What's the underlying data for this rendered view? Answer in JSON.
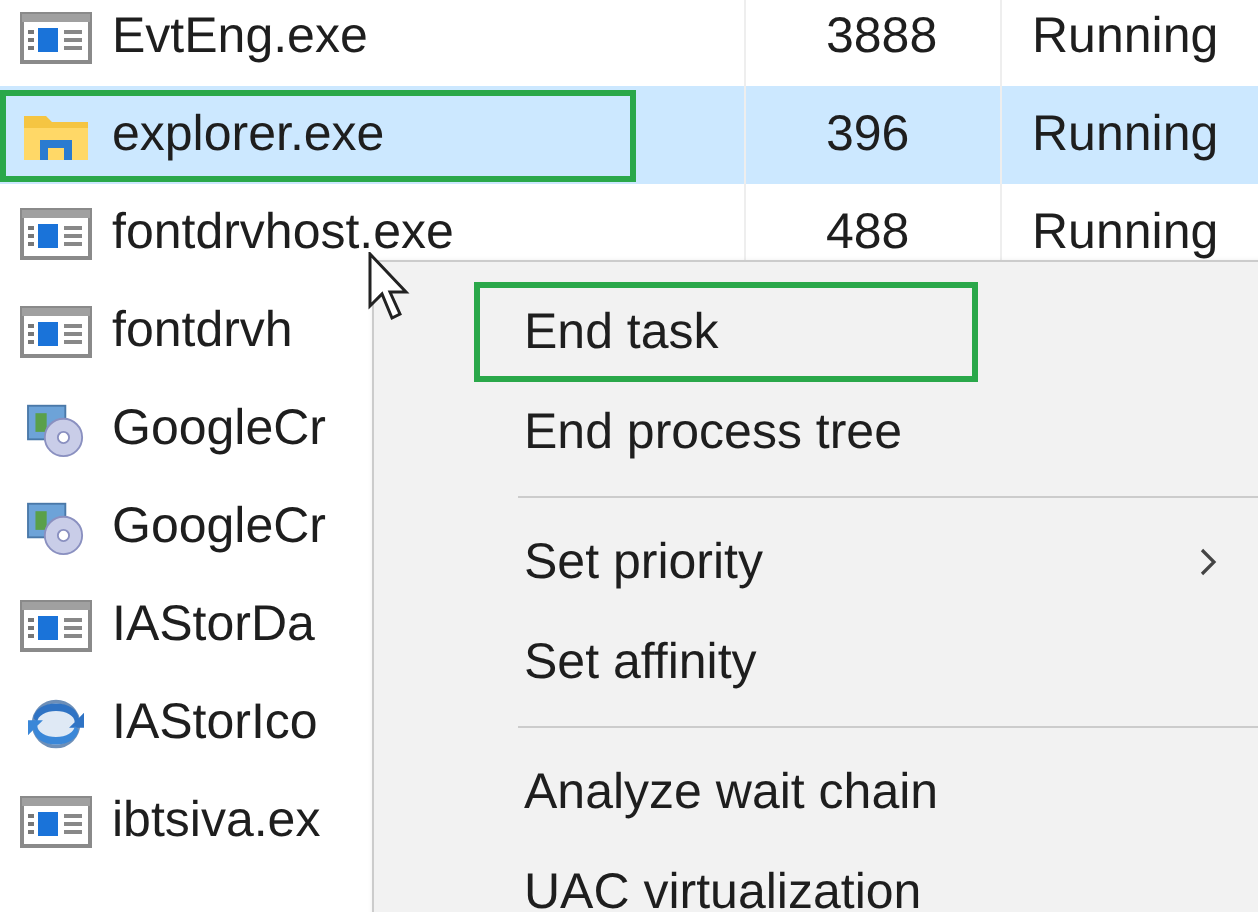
{
  "processes": [
    {
      "kind": "app",
      "name": "EvtEng.exe",
      "pid": "3888",
      "status": "Running",
      "selected": false,
      "highlighted": false
    },
    {
      "kind": "folder",
      "name": "explorer.exe",
      "pid": "396",
      "status": "Running",
      "selected": true,
      "highlighted": true
    },
    {
      "kind": "app",
      "name": "fontdrvhost.exe",
      "pid": "488",
      "status": "Running",
      "selected": false,
      "highlighted": false
    },
    {
      "kind": "app",
      "name": "fontdrvh",
      "selected": false,
      "highlighted": false
    },
    {
      "kind": "disc",
      "name": "GoogleCr",
      "selected": false,
      "highlighted": false
    },
    {
      "kind": "disc",
      "name": "GoogleCr",
      "selected": false,
      "highlighted": false
    },
    {
      "kind": "app",
      "name": "IAStorDa",
      "selected": false,
      "highlighted": false
    },
    {
      "kind": "sync",
      "name": "IAStorIco",
      "selected": false,
      "highlighted": false
    },
    {
      "kind": "app",
      "name": "ibtsiva.ex",
      "selected": false,
      "highlighted": false
    }
  ],
  "context_menu": {
    "groups": [
      [
        {
          "label": "End task",
          "submenu": false,
          "highlighted": true
        },
        {
          "label": "End process tree",
          "submenu": false,
          "highlighted": false
        }
      ],
      [
        {
          "label": "Set priority",
          "submenu": true,
          "highlighted": false
        },
        {
          "label": "Set affinity",
          "submenu": false,
          "highlighted": false
        }
      ],
      [
        {
          "label": "Analyze wait chain",
          "submenu": false,
          "highlighted": false
        },
        {
          "label": "UAC virtualization",
          "submenu": false,
          "highlighted": false
        }
      ]
    ]
  }
}
